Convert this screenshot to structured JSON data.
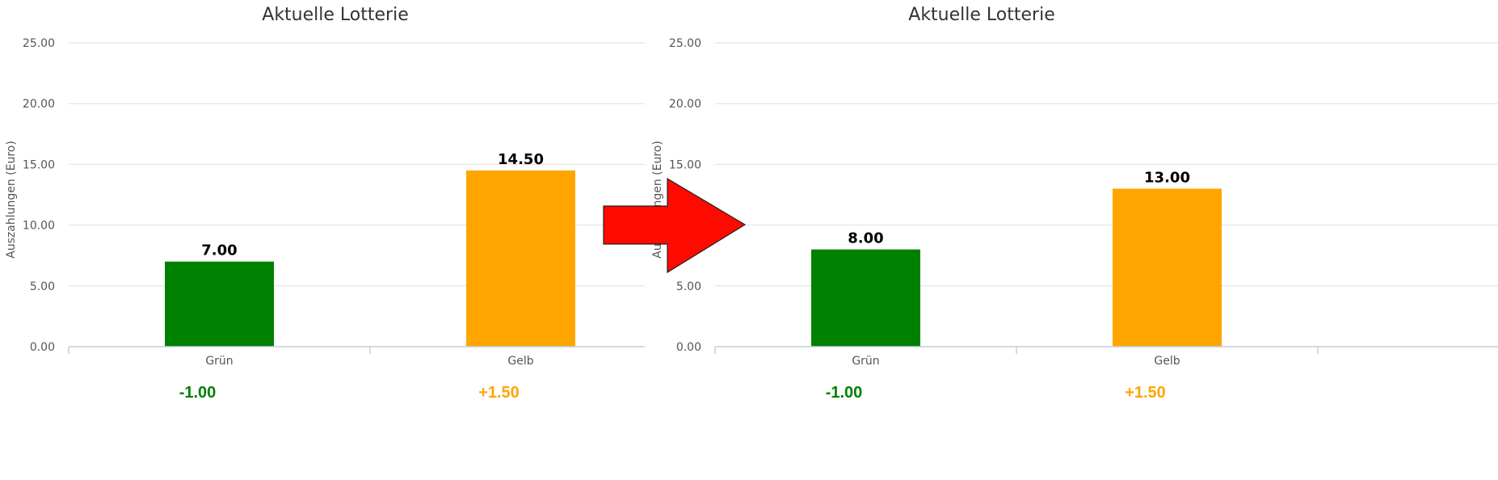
{
  "colors": {
    "green": "#008000",
    "orange": "#ffa500",
    "arrow": "#ff0a00"
  },
  "icons": {
    "arrow": "right-arrow-icon"
  },
  "chart_data": [
    {
      "type": "bar",
      "title": "Aktuelle Lotterie",
      "ylabel": "Auszahlungen (Euro)",
      "xlabel": "",
      "categories": [
        "Grün",
        "Gelb"
      ],
      "values": [
        7.0,
        14.5
      ],
      "value_labels": [
        "7.00",
        "14.50"
      ],
      "bar_colors": [
        "#008000",
        "#ffa500"
      ],
      "ylim": [
        0,
        25
      ],
      "yticks": [
        "0.00",
        "5.00",
        "10.00",
        "15.00",
        "20.00",
        "25.00"
      ],
      "grid": true,
      "annotations": [
        {
          "text": "-1.00",
          "color": "#008000"
        },
        {
          "text": "+1.50",
          "color": "#ffa500"
        }
      ]
    },
    {
      "type": "bar",
      "title": "Aktuelle Lotterie",
      "ylabel": "Auszahlungen (Euro)",
      "xlabel": "",
      "categories": [
        "Grün",
        "Gelb"
      ],
      "values": [
        8.0,
        13.0
      ],
      "value_labels": [
        "8.00",
        "13.00"
      ],
      "bar_colors": [
        "#008000",
        "#ffa500"
      ],
      "ylim": [
        0,
        25
      ],
      "yticks": [
        "0.00",
        "5.00",
        "10.00",
        "15.00",
        "20.00",
        "25.00"
      ],
      "grid": true,
      "annotations": [
        {
          "text": "-1.00",
          "color": "#008000"
        },
        {
          "text": "+1.50",
          "color": "#ffa500"
        }
      ]
    }
  ]
}
